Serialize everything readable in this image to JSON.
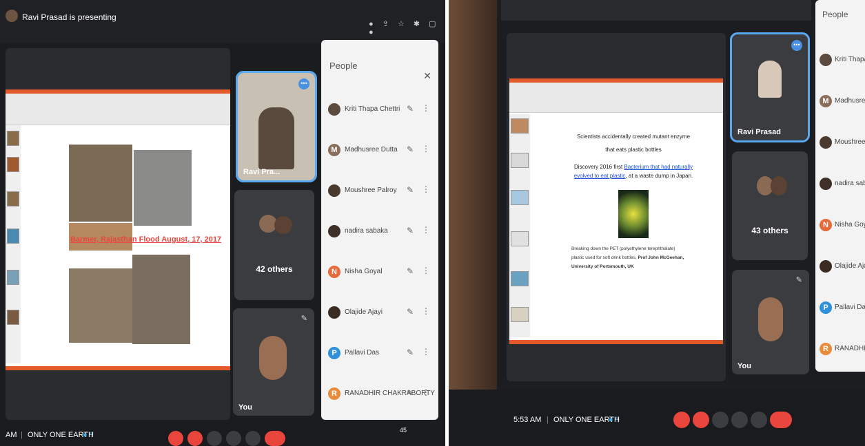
{
  "left_screen": {
    "banner": "Ravi Prasad is presenting",
    "slide_caption": "Barmer, Rajasthan Flood August, 17, 2017",
    "tiles": {
      "presenter_label": "Ravi Pra...",
      "others_label": "42 others",
      "self_label": "You"
    },
    "people_panel": {
      "title": "People",
      "close_icon": "close-icon",
      "participants": [
        {
          "name": "Kriti Thapa Chettri",
          "initial": "",
          "color": "#5b4a3e"
        },
        {
          "name": "Madhusree Dutta",
          "initial": "M",
          "color": "#8b6e5a"
        },
        {
          "name": "Moushree Palroy",
          "initial": "",
          "color": "#4a3a2e"
        },
        {
          "name": "nadira sabaka",
          "initial": "",
          "color": "#3e3028"
        },
        {
          "name": "Nisha Goyal",
          "initial": "N",
          "color": "#e66a3c"
        },
        {
          "name": "Olajide Ajayi",
          "initial": "",
          "color": "#3a2c22"
        },
        {
          "name": "Pallavi Das",
          "initial": "P",
          "color": "#2f8fd8"
        },
        {
          "name": "RANADHIR CHAKRABORTY",
          "initial": "R",
          "color": "#e88b3a"
        }
      ]
    },
    "bottom": {
      "time": "AM",
      "meeting_name": "ONLY ONE EARTH",
      "people_count": "45"
    }
  },
  "right_screen": {
    "tiles": {
      "presenter_label": "Ravi Prasad",
      "others_label": "43 others",
      "self_label": "You"
    },
    "slide": {
      "headline_1": "Scientists accidentally created mutant enzyme",
      "headline_2": "that eats plastic bottles",
      "discovery_prefix": "Discovery 2016 first",
      "discovery_link": "Bacterium that had naturally evolved to eat plastic",
      "discovery_suffix": ", at a waste dump in Japan.",
      "caption_1": "Breaking down the PET (polyethylene terephthalate)",
      "caption_2": "plastic used for soft drink bottles,",
      "caption_3": "Prof John McGeehan,",
      "caption_4": "University of Portsmouth, UK"
    },
    "people_panel": {
      "title": "People",
      "participants": [
        {
          "name": "Kriti Thapa Ch",
          "initial": "",
          "color": "#5b4a3e"
        },
        {
          "name": "Madhusree D",
          "initial": "M",
          "color": "#8b6e5a"
        },
        {
          "name": "Moushree Pal",
          "initial": "",
          "color": "#4a3a2e"
        },
        {
          "name": "nadira sabak",
          "initial": "",
          "color": "#3e3028"
        },
        {
          "name": "Nisha Goyal",
          "initial": "N",
          "color": "#e66a3c"
        },
        {
          "name": "Olajide Ajayi",
          "initial": "",
          "color": "#3a2c22"
        },
        {
          "name": "Pallavi Das",
          "initial": "P",
          "color": "#2f8fd8"
        },
        {
          "name": "RANADHIRCH",
          "initial": "R",
          "color": "#e88b3a"
        }
      ]
    },
    "bottom": {
      "time": "5:53 AM",
      "meeting_name": "ONLY ONE EARTH"
    }
  },
  "colors": {
    "accent_red": "#e8453c",
    "accent_orange": "#e35b2a",
    "selected_blue": "#5aa9f0",
    "link_blue": "#1a4fd6"
  }
}
